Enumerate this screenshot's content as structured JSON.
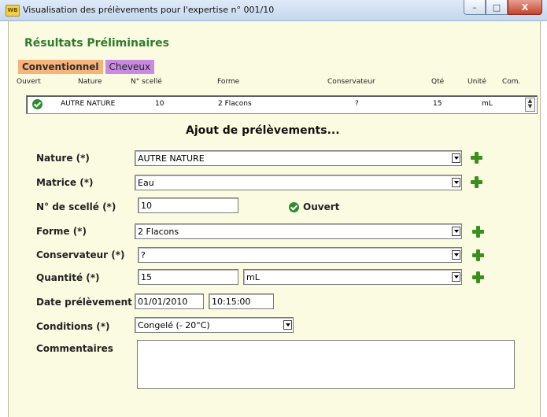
{
  "window": {
    "title": "Visualisation des prélèvements pour l'expertise n° 001/10",
    "icon": "wb-app-icon",
    "app_icon_text": "WB",
    "controls": {
      "minimize": "–",
      "maximize": "□",
      "close": "X"
    }
  },
  "results_title": "Résultats Préliminaires",
  "tabs": [
    {
      "label": "Conventionnel",
      "active": true
    },
    {
      "label": "Cheveux",
      "active": false
    }
  ],
  "table": {
    "headers": [
      "Ouvert",
      "Nature",
      "N° scellé",
      "Forme",
      "Conservateur",
      "Qté",
      "Unité",
      "Com."
    ],
    "rows": [
      {
        "ouvert_icon": "check-circle-icon",
        "nature": "AUTRE NATURE",
        "scelle": "10",
        "forme": "2 Flacons",
        "conservateur": "?",
        "qte": "15",
        "unite": "mL"
      }
    ]
  },
  "form": {
    "title": "Ajout de prélèvements...",
    "nature": {
      "label": "Nature (*)",
      "value": "AUTRE NATURE"
    },
    "matrice": {
      "label": "Matrice (*)",
      "value": "Eau"
    },
    "scelle": {
      "label": "N° de scellé (*)",
      "value": "10"
    },
    "ouvert": {
      "label": "Ouvert",
      "icon": "check-circle-icon"
    },
    "forme": {
      "label": "Forme (*)",
      "value": "2 Flacons"
    },
    "conservateur": {
      "label": "Conservateur (*)",
      "value": "?"
    },
    "quantite": {
      "label": "Quantité (*)",
      "value": "15",
      "unit": "mL"
    },
    "date": {
      "label": "Date prélèvement",
      "date": "01/01/2010",
      "time": "10:15:00"
    },
    "conditions": {
      "label": "Conditions (*)",
      "value": "Congelé (- 20°C)"
    },
    "commentaires": {
      "label": "Commentaires",
      "value": ""
    }
  },
  "colors": {
    "background": "#fbfbe2",
    "accent_green": "#2f7a2f",
    "tab_active": "#f7b47a",
    "tab_inactive": "#c98be0"
  }
}
